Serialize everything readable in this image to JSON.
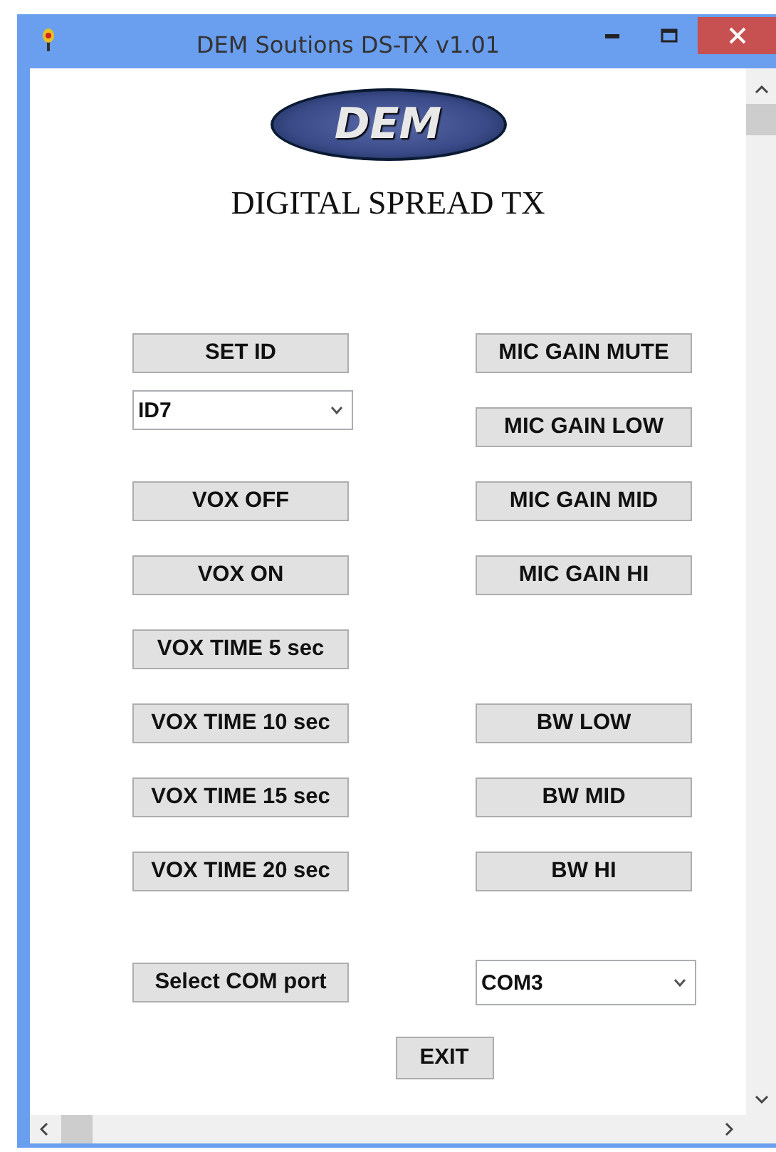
{
  "window": {
    "title": "DEM Soutions DS-TX v1.01"
  },
  "logo_text": "DEM",
  "heading": "DIGITAL SPREAD TX",
  "rows": [
    {
      "left": {
        "kind": "button",
        "label": "SET ID"
      },
      "right": {
        "kind": "button",
        "label": "MIC GAIN MUTE"
      }
    },
    {
      "left": {
        "kind": "select",
        "value": "ID7"
      },
      "right": {
        "kind": "button",
        "label": "MIC GAIN LOW"
      }
    },
    {
      "left": {
        "kind": "button",
        "label": "VOX OFF"
      },
      "right": {
        "kind": "button",
        "label": "MIC GAIN MID"
      }
    },
    {
      "left": {
        "kind": "button",
        "label": "VOX ON"
      },
      "right": {
        "kind": "button",
        "label": "MIC GAIN HI"
      }
    },
    {
      "left": {
        "kind": "button",
        "label": "VOX TIME 5 sec"
      }
    },
    {
      "left": {
        "kind": "button",
        "label": "VOX TIME 10 sec"
      },
      "right": {
        "kind": "button",
        "label": "BW LOW"
      }
    },
    {
      "left": {
        "kind": "button",
        "label": "VOX TIME 15 sec"
      },
      "right": {
        "kind": "button",
        "label": "BW MID"
      }
    },
    {
      "left": {
        "kind": "button",
        "label": "VOX TIME 20 sec"
      },
      "right": {
        "kind": "button",
        "label": "BW HI"
      }
    }
  ],
  "com_port": {
    "button": "Select COM port",
    "value": "COM3"
  },
  "exit_button": "EXIT"
}
